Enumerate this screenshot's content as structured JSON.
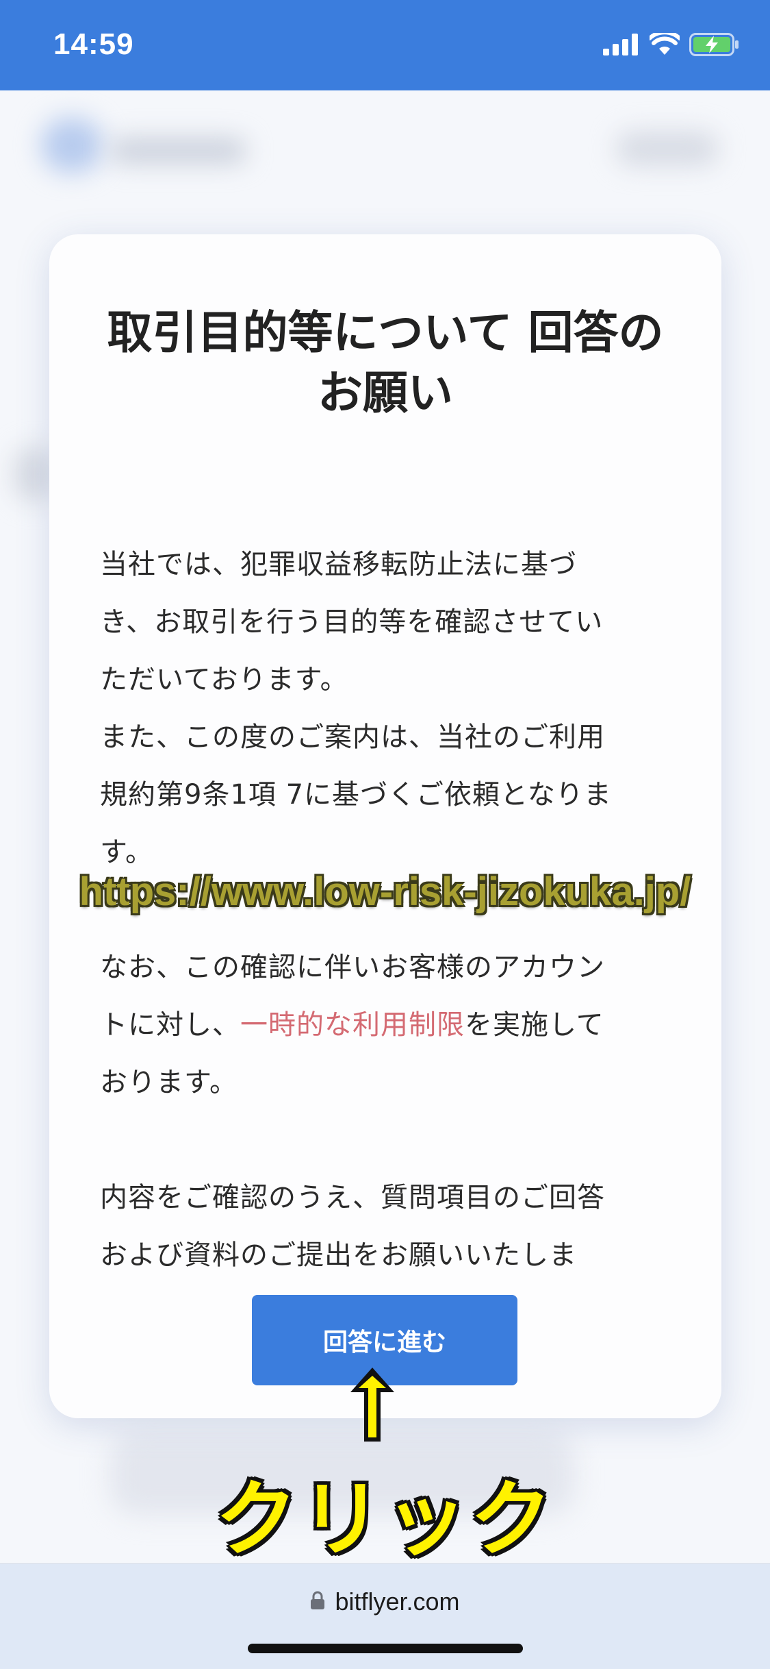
{
  "status_bar": {
    "time": "14:59",
    "icons": [
      "signal-icon",
      "wifi-icon",
      "battery-charging-icon"
    ]
  },
  "modal": {
    "title": "取引目的等について 回答のお願い",
    "body": {
      "p1_line1": "当社では、犯罪収益移転防止法に基づ",
      "p1_line2": "き、お取引を行う目的等を確認させてい",
      "p1_line3": "ただいております。",
      "p2_line1": "また、この度のご案内は、当社のご利用",
      "p2_line2": "規約第9条1項 7に基づくご依頼となりま",
      "p2_line3": "す。",
      "p3_line1": "なお、この確認に伴いお客様のアカウン",
      "p3_line2_prefix": "トに対し、",
      "p3_line2_highlight": "一時的な利用制限",
      "p3_line2_suffix": "を実施して",
      "p3_line3": "おります。",
      "p4_line1": "内容をご確認のうえ、質問項目のご回答",
      "p4_line2": "および資料のご提出をお願いいたしま"
    },
    "button_label": "回答に進む"
  },
  "annotations": {
    "url_text": "https://www.low-risk-jizokuka.jp/",
    "arrow_glyph": "↑",
    "click_label": "クリック"
  },
  "browser": {
    "domain": "bitflyer.com"
  },
  "colors": {
    "brand_blue": "#3b7ddd",
    "highlight_red": "#d46a72",
    "annotation_yellow": "#fff200"
  }
}
